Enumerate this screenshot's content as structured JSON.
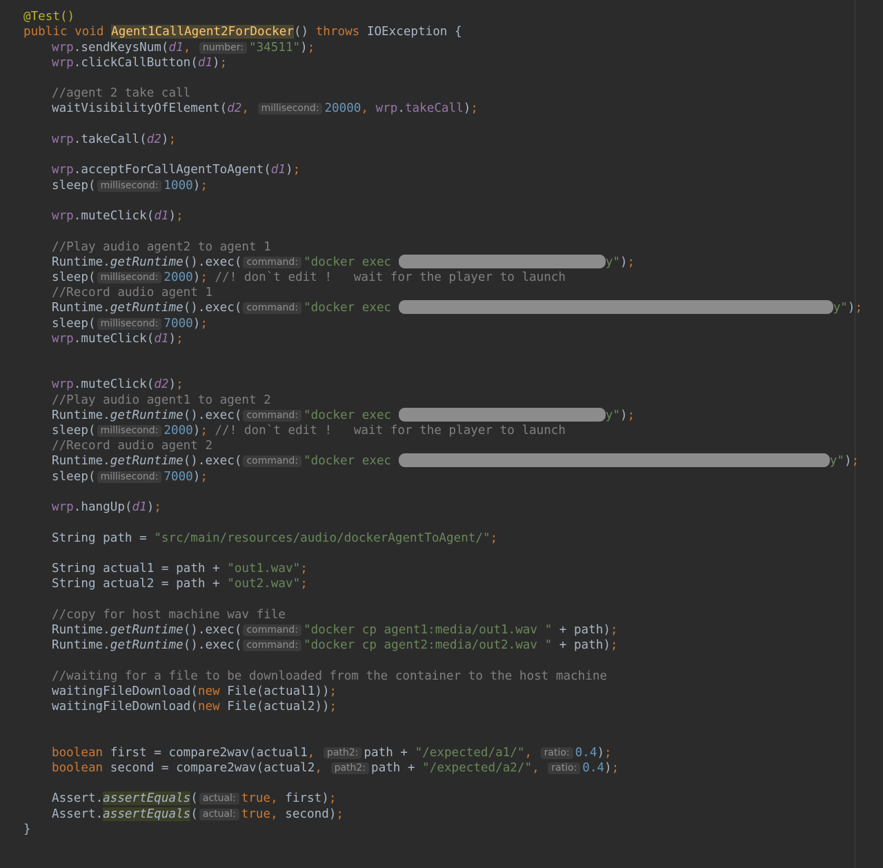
{
  "method": {
    "annotation": "@Test()",
    "kw_public": "public",
    "kw_void": "void",
    "name": "Agent1CallAgent2ForDocker",
    "parens": "()",
    "kw_throws": "throws",
    "exception": "IOException",
    "open_brace": "{",
    "close_brace": "}"
  },
  "tokens": {
    "wrp": "wrp",
    "d1": "d1",
    "d2": "d2",
    "dot": ".",
    "lp": "(",
    "rp": ")",
    "semi": ";",
    "comma": ", ",
    "end": ");",
    "sleep": "sleep",
    "runtime": "Runtime",
    "get_runtime": "getRuntime",
    "exec_call": "().exec(",
    "docker_exec": "\"docker exec ",
    "redacted_tail": "\"",
    "redacted_tail_y": "y\"",
    "string_kw": "String",
    "eq": " = ",
    "plus": " + ",
    "path": "path",
    "new_kw": "new",
    "file": "File",
    "boolean_kw": "boolean",
    "assert": "Assert",
    "assert_equals": "assertEquals",
    "true_kw": "true",
    "dont_edit": " //! don`t edit !   wait for the player to launch"
  },
  "hints": {
    "number": "number:",
    "millisecond": "millisecond:",
    "command": "command:",
    "path2": "path2:",
    "ratio": "ratio:",
    "actual": "actual:"
  },
  "calls": {
    "sendKeysNum": "sendKeysNum",
    "clickCallButton": "clickCallButton",
    "waitVisibilityOfElement": "waitVisibilityOfElement",
    "takeCall": "takeCall",
    "acceptForCallAgentToAgent": "acceptForCallAgentToAgent",
    "muteClick": "muteClick",
    "hangUp": "hangUp",
    "waitingFileDownload": "waitingFileDownload",
    "compare2wav": "compare2wav"
  },
  "values": {
    "number": "\"34511\"",
    "ms_20000": "20000",
    "ms_1000": "1000",
    "ms_2000": "2000",
    "ms_7000": "7000",
    "path_str": "\"src/main/resources/audio/dockerAgentToAgent/\"",
    "out1": "\"out1.wav\"",
    "out2": "\"out2.wav\"",
    "cp1": "\"docker cp agent1:media/out1.wav \"",
    "cp2": "\"docker cp agent2:media/out2.wav \"",
    "expected_a1": "\"/expected/a1/\"",
    "expected_a2": "\"/expected/a2/\"",
    "ratio": "0.4"
  },
  "vars": {
    "actual1": "actual1",
    "actual2": "actual2",
    "first": "first",
    "second": "second"
  },
  "comments": {
    "take_call": "//agent 2 take call",
    "play_2_to_1": "//Play audio agent2 to agent 1",
    "record_1": "//Record audio agent 1",
    "play_1_to_2": "//Play audio agent1 to agent 2",
    "record_2": "//Record audio agent 2",
    "copy_host": "//copy for host machine wav file",
    "waiting_file": "//waiting for a file to be downloaded from the container to the host machine"
  }
}
